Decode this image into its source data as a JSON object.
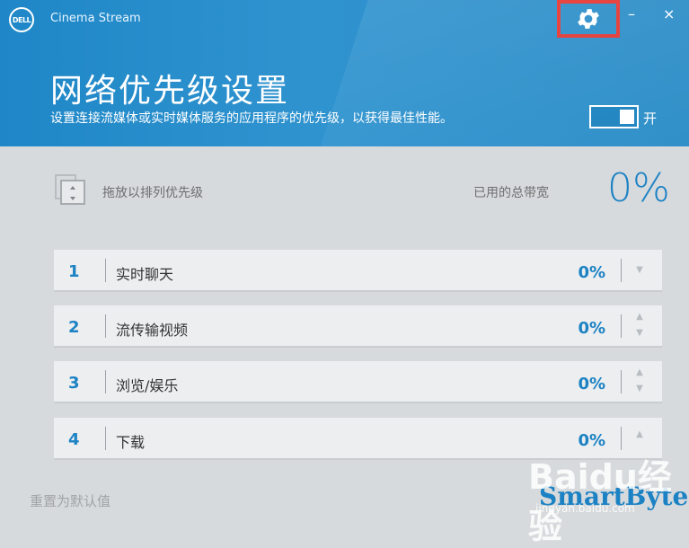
{
  "window": {
    "brand_logo_text": "DELL",
    "app_title": "Cinema Stream",
    "minimize_label": "–",
    "close_label": "×"
  },
  "header": {
    "title": "网络优先级设置",
    "subtitle": "设置连接流媒体或实时媒体服务的应用程序的优先级，以获得最佳性能。",
    "toggle_label": "开",
    "toggle_state": "on",
    "icons": {
      "settings": "gear-icon"
    }
  },
  "main": {
    "drag_hint": "拖放以排列优先级",
    "bandwidth_label": "已用的总带宽",
    "bandwidth_value": "0%",
    "rows": [
      {
        "rank": "1",
        "label": "实时聊天",
        "percent": "0%",
        "arrows": [
          "down"
        ]
      },
      {
        "rank": "2",
        "label": "流传输视频",
        "percent": "0%",
        "arrows": [
          "up",
          "down"
        ]
      },
      {
        "rank": "3",
        "label": "浏览/娱乐",
        "percent": "0%",
        "arrows": [
          "up",
          "down"
        ]
      },
      {
        "rank": "4",
        "label": "下载",
        "percent": "0%",
        "arrows": [
          "up"
        ]
      }
    ]
  },
  "footer": {
    "reset_label": "重置为默认值",
    "brand": "SmartByte",
    "watermark": "Baidu经验",
    "watermark_sub": "jingyan.baidu.com"
  },
  "colors": {
    "header_blue": "#2a8fcb",
    "accent_blue": "#1c82c4",
    "highlight_red": "#e53935",
    "background_gray": "#d7dadd"
  }
}
